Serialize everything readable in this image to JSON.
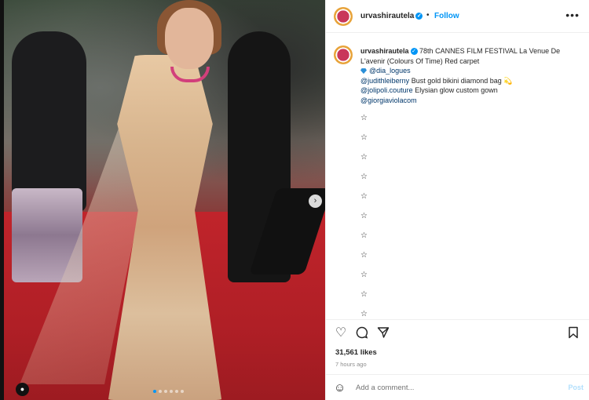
{
  "post": {
    "username": "urvashirautela",
    "separator": "•",
    "follow_label": "Follow",
    "more_icon": "more-horizontal-icon"
  },
  "caption": {
    "line1": "78th CANNES FILM FESTIVAL La Venue De L'avenir (Colours Of Time) Red carpet",
    "mention1": "@dia_logues",
    "mention2": "@judithleiberny",
    "mention2_text": "Bust gold bikini diamond bag 💫",
    "mention3": "@jolipoli.couture",
    "mention3_text": "Elysian glow custom gown",
    "mention4": "@giorgiaviolacom",
    "stars": [
      "☆",
      "☆",
      "☆",
      "☆",
      "☆",
      "☆",
      "☆",
      "☆",
      "☆",
      "☆",
      "☆"
    ]
  },
  "engagement": {
    "likes": "31,561 likes",
    "time": "7 hours ago"
  },
  "comment": {
    "placeholder": "Add a comment...",
    "post_label": "Post"
  },
  "carousel": {
    "next_icon": "chevron-right-icon",
    "slide_count": 6,
    "active_slide": 1
  },
  "colors": {
    "accent": "#0095f6",
    "link": "#00376b",
    "post_disabled": "#b2dffc"
  }
}
